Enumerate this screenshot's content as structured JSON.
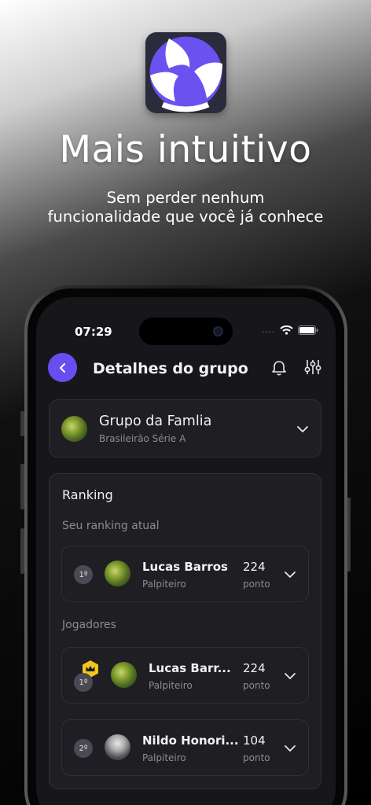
{
  "promo": {
    "headline": "Mais intuitivo",
    "subline_1": "Sem perder nenhum",
    "subline_2": "funcionalidade que você já conhece"
  },
  "status_bar": {
    "time": "07:29",
    "signal_dots": "...."
  },
  "header": {
    "title": "Detalhes do grupo"
  },
  "group": {
    "name": "Grupo da Famlia",
    "league": "Brasileirão Série A"
  },
  "ranking": {
    "title": "Ranking",
    "current_label": "Seu ranking atual",
    "players_label": "Jogadores",
    "current": {
      "rank": "1º",
      "name": "Lucas Barros",
      "role": "Palpiteiro",
      "points": "224",
      "unit": "ponto"
    },
    "players": [
      {
        "rank": "1º",
        "name": "Lucas Barr...",
        "role": "Palpiteiro",
        "points": "224",
        "unit": "ponto",
        "leader": true
      },
      {
        "rank": "2º",
        "name": "Nildo Honori...",
        "role": "Palpiteiro",
        "points": "104",
        "unit": "ponto",
        "leader": false
      }
    ]
  },
  "colors": {
    "accent": "#6a4df0",
    "crown": "#f2c51b",
    "card": "#1e1e23"
  }
}
